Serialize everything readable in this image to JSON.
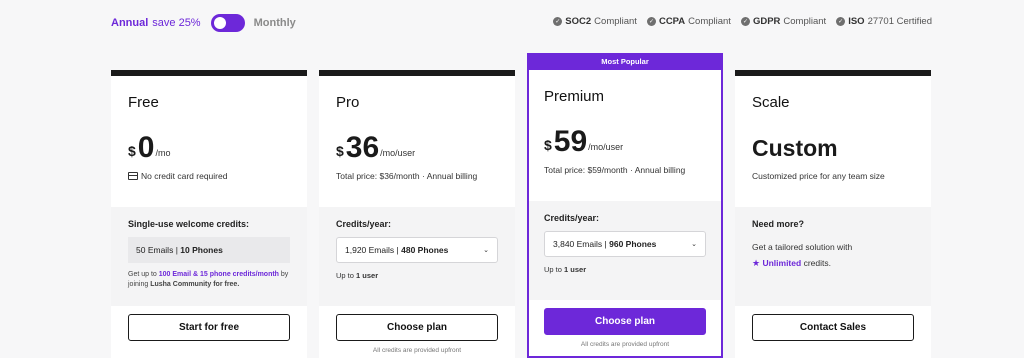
{
  "billing": {
    "annual_label": "Annual",
    "save_label": "save 25%",
    "monthly_label": "Monthly"
  },
  "compliance": [
    {
      "bold": "SOC2",
      "rest": "Compliant"
    },
    {
      "bold": "CCPA",
      "rest": "Compliant"
    },
    {
      "bold": "GDPR",
      "rest": "Compliant"
    },
    {
      "bold": "ISO",
      "rest": "27701 Certified"
    }
  ],
  "colors": {
    "accent": "#6d28d9",
    "dark": "#1a1a1a"
  },
  "plans": [
    {
      "name": "Free",
      "currency": "$",
      "amount": "0",
      "per": "/mo",
      "sub": "No credit card required",
      "mid_title": "Single-use welcome credits:",
      "credits_emails": "50 Emails",
      "credits_sep": "|",
      "credits_phones": "10 Phones",
      "note_pre": "Get up to",
      "note_hl": "100 Email & 15 phone credits/month",
      "note_mid": "by joining",
      "note_bold": "Lusha Community for free.",
      "button": "Start for free"
    },
    {
      "name": "Pro",
      "currency": "$",
      "amount": "36",
      "per": "/mo/user",
      "sub": "Total price: $36/month · Annual billing",
      "mid_title": "Credits/year:",
      "select_emails": "1,920 Emails",
      "select_sep": "|",
      "select_phones": "480 Phones",
      "up_to_pre": "Up to",
      "up_to_bold": "1 user",
      "button": "Choose plan",
      "fine": "All credits are provided upfront"
    },
    {
      "badge": "Most Popular",
      "name": "Premium",
      "currency": "$",
      "amount": "59",
      "per": "/mo/user",
      "sub": "Total price: $59/month · Annual billing",
      "mid_title": "Credits/year:",
      "select_emails": "3,840 Emails",
      "select_sep": "|",
      "select_phones": "960 Phones",
      "up_to_pre": "Up to",
      "up_to_bold": "1 user",
      "button": "Choose plan",
      "fine": "All credits are provided upfront"
    },
    {
      "name": "Scale",
      "custom": "Custom",
      "sub": "Customized price for any team size",
      "mid_title": "Need more?",
      "desc": "Get a tailored solution with",
      "unlimited": "Unlimited",
      "credits_word": "credits.",
      "button": "Contact Sales"
    }
  ]
}
